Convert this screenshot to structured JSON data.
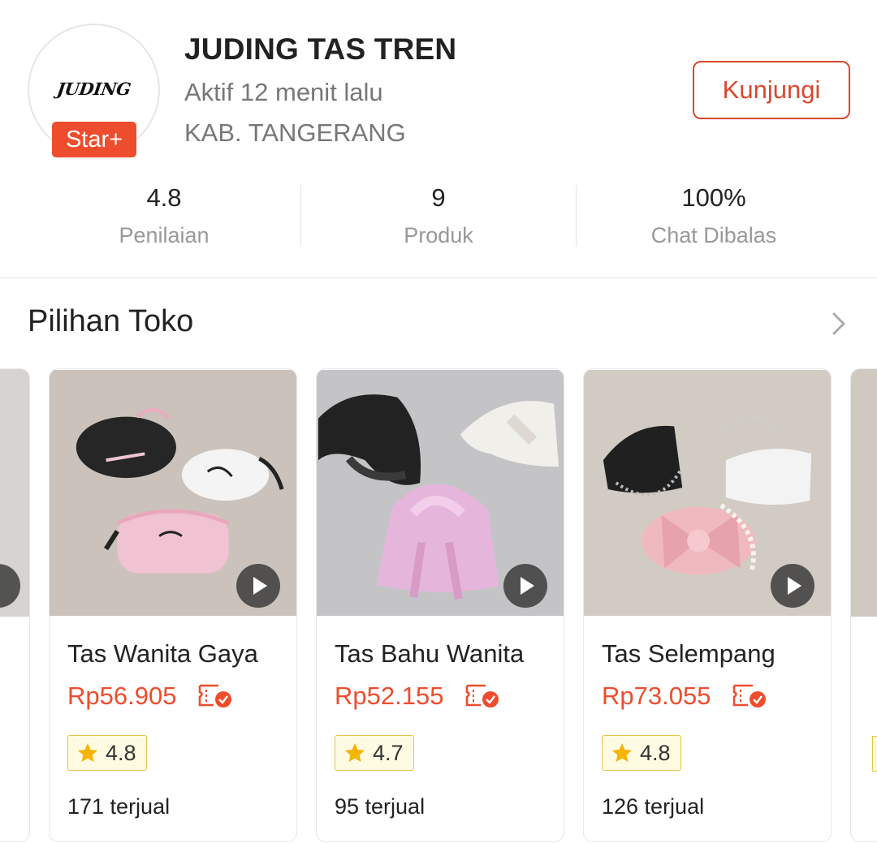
{
  "shop": {
    "logo_text": "JUDING",
    "badge": "Star+",
    "name": "JUDING TAS TREN",
    "active_status": "Aktif 12 menit lalu",
    "location": "KAB. TANGERANG",
    "visit_label": "Kunjungi"
  },
  "stats": [
    {
      "value": "4.8",
      "label": "Penilaian"
    },
    {
      "value": "9",
      "label": "Produk"
    },
    {
      "value": "100%",
      "label": "Chat Dibalas"
    }
  ],
  "section": {
    "title": "Pilihan Toko"
  },
  "products": [
    {
      "title": "Tas Wanita Gaya",
      "price": "Rp56.905",
      "rating": "4.8",
      "sold": "171 terjual"
    },
    {
      "title": "Tas Bahu Wanita",
      "price": "Rp52.155",
      "rating": "4.7",
      "sold": "95 terjual"
    },
    {
      "title": "Tas Selempang",
      "price": "Rp73.055",
      "rating": "4.8",
      "sold": "126 terjual"
    }
  ],
  "colors": {
    "accent": "#ee4d2d",
    "rating_bg": "#fffbe3",
    "rating_border": "#e5c34a",
    "star": "#f5b400"
  },
  "icons": [
    "play-icon",
    "voucher-icon",
    "star-icon",
    "chevron-right-icon"
  ]
}
